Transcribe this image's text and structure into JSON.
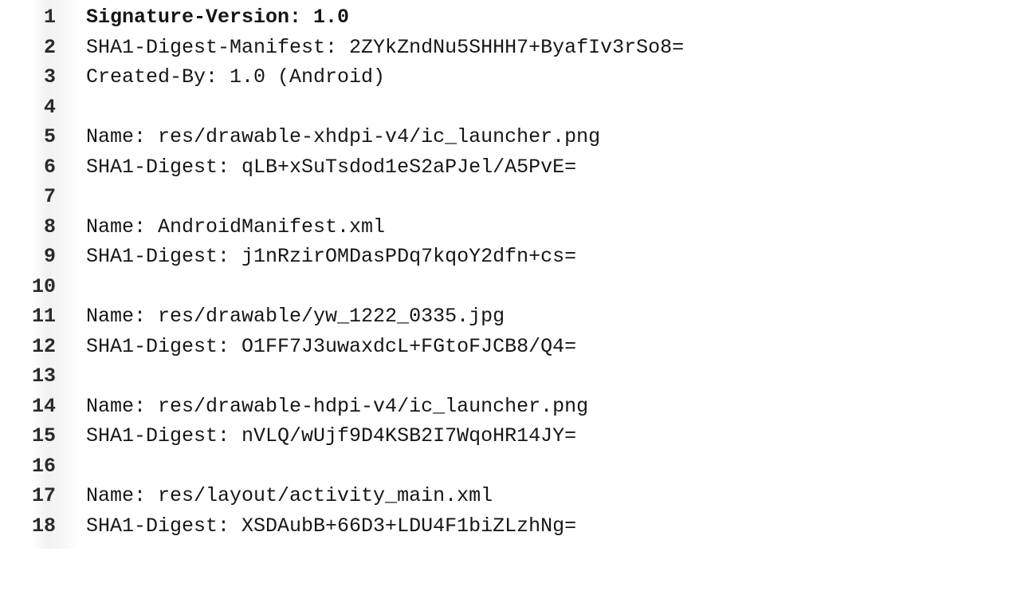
{
  "editor": {
    "lines": [
      {
        "number": "1",
        "text": "Signature-Version: 1.0"
      },
      {
        "number": "2",
        "text": "SHA1-Digest-Manifest: 2ZYkZndNu5SHHH7+ByafIv3rSo8="
      },
      {
        "number": "3",
        "text": "Created-By: 1.0 (Android)"
      },
      {
        "number": "4",
        "text": ""
      },
      {
        "number": "5",
        "text": "Name: res/drawable-xhdpi-v4/ic_launcher.png"
      },
      {
        "number": "6",
        "text": "SHA1-Digest: qLB+xSuTsdod1eS2aPJel/A5PvE="
      },
      {
        "number": "7",
        "text": ""
      },
      {
        "number": "8",
        "text": "Name: AndroidManifest.xml"
      },
      {
        "number": "9",
        "text": "SHA1-Digest: j1nRzirOMDasPDq7kqoY2dfn+cs="
      },
      {
        "number": "10",
        "text": ""
      },
      {
        "number": "11",
        "text": "Name: res/drawable/yw_1222_0335.jpg"
      },
      {
        "number": "12",
        "text": "SHA1-Digest: O1FF7J3uwaxdcL+FGtoFJCB8/Q4="
      },
      {
        "number": "13",
        "text": ""
      },
      {
        "number": "14",
        "text": "Name: res/drawable-hdpi-v4/ic_launcher.png"
      },
      {
        "number": "15",
        "text": "SHA1-Digest: nVLQ/wUjf9D4KSB2I7WqoHR14JY="
      },
      {
        "number": "16",
        "text": ""
      },
      {
        "number": "17",
        "text": "Name: res/layout/activity_main.xml"
      },
      {
        "number": "18",
        "text": "SHA1-Digest: XSDAubB+66D3+LDU4F1biZLzhNg="
      }
    ]
  }
}
